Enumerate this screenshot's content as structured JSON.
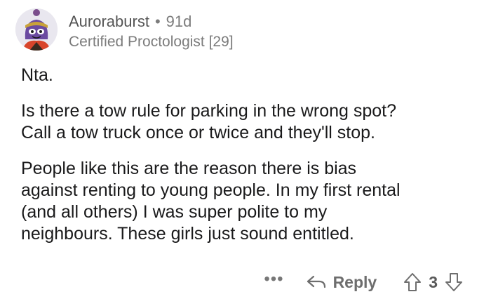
{
  "comment": {
    "author": "Auroraburst",
    "separator": "•",
    "age": "91d",
    "flair": "Certified Proctologist [29]",
    "paragraphs": [
      "Nta.",
      "Is there a tow rule for parking in the wrong spot?\nCall a tow truck once or twice and they'll stop.",
      "People like this are the reason there is bias\nagainst renting to young people. In my first rental\n(and all others) I was super polite to my\nneighbours. These girls just sound entitled."
    ],
    "actions": {
      "more": "•••",
      "reply_label": "Reply",
      "score": "3"
    }
  },
  "icons": {
    "avatar": "snoo-avatar",
    "reply": "reply-arrow-icon",
    "upvote": "upvote-arrow-icon",
    "downvote": "downvote-arrow-icon"
  },
  "colors": {
    "meta_text": "#7c7c7c",
    "body_text": "#1a1a1b",
    "action_text": "#6e6e6e"
  }
}
